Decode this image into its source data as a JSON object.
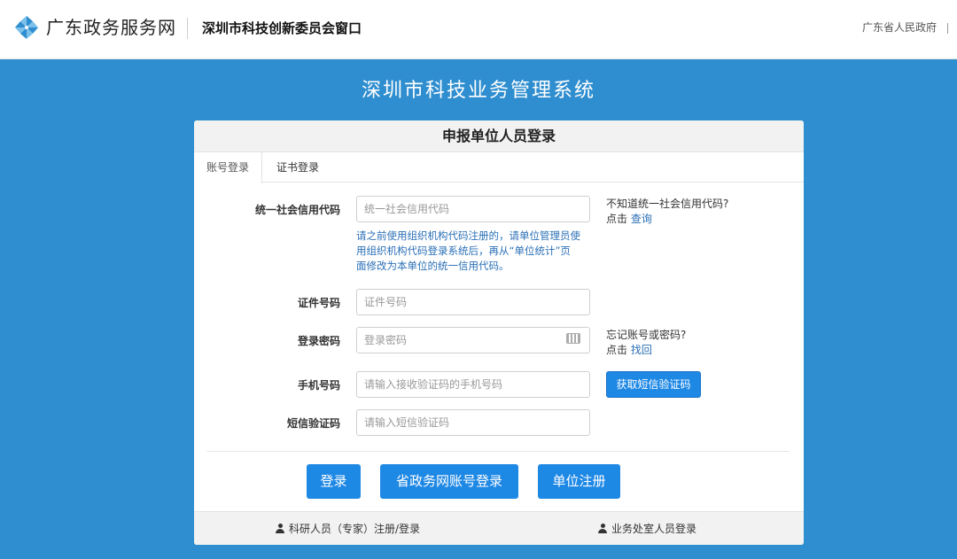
{
  "header": {
    "logo_text": "广东政务服务网",
    "subtitle": "深圳市科技创新委员会窗口",
    "right_link": "广东省人民政府"
  },
  "system_title": "深圳市科技业务管理系统",
  "card": {
    "title": "申报单位人员登录",
    "tabs": [
      {
        "label": "账号登录",
        "active": true
      },
      {
        "label": "证书登录",
        "active": false
      }
    ],
    "fields": {
      "credit_code": {
        "label": "统一社会信用代码",
        "placeholder": "统一社会信用代码"
      },
      "cert_number": {
        "label": "证件号码",
        "placeholder": "证件号码"
      },
      "password": {
        "label": "登录密码",
        "placeholder": "登录密码"
      },
      "phone": {
        "label": "手机号码",
        "placeholder": "请输入接收验证码的手机号码"
      },
      "sms_code": {
        "label": "短信验证码",
        "placeholder": "请输入短信验证码"
      }
    },
    "hint_lines": [
      "请之前使用组织机构代码注册的，请单位管理员使",
      "用组织机构代码登录系统后，再从“单位统计”页",
      "面修改为本单位的统一信用代码。"
    ],
    "tips": {
      "credit_q": "不知道统一社会信用代码?",
      "credit_click": "点击",
      "credit_link": "查询",
      "forgot_q": "忘记账号或密码?",
      "forgot_click": "点击",
      "forgot_link": "找回"
    },
    "sms_button": "获取短信验证码",
    "buttons": {
      "login": "登录",
      "gov_login": "省政务网账号登录",
      "register": "单位注册"
    },
    "footer": {
      "researcher": "科研人员（专家）注册/登录",
      "office": "业务处室人员登录"
    }
  },
  "colors": {
    "background": "#2f8ecf",
    "primary_button": "#1e88e5",
    "link": "#2a6fb6"
  }
}
